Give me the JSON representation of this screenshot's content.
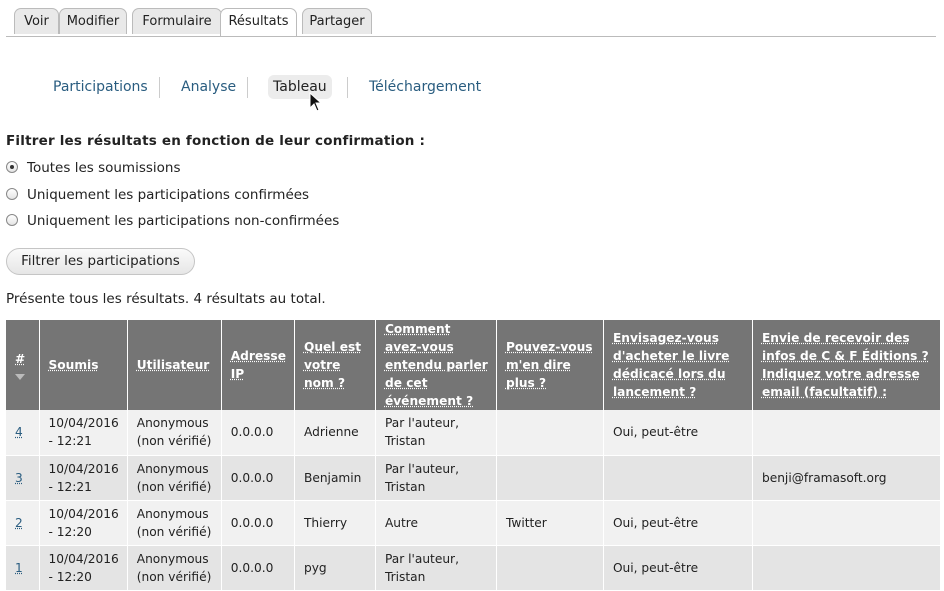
{
  "primary_tabs": [
    "Voir",
    "Modifier",
    "Formulaire",
    "Résultats",
    "Partager"
  ],
  "secondary_tabs": [
    "Participations",
    "Analyse",
    "Tableau",
    "Téléchargement"
  ],
  "filter": {
    "title": "Filtrer les résultats en fonction de leur confirmation :",
    "options": [
      "Toutes les soumissions",
      "Uniquement les participations confirmées",
      "Uniquement les participations non-confirmées"
    ],
    "selected": "Toutes les soumissions",
    "button": "Filtrer les participations"
  },
  "summary": "Présente tous les résultats. 4 résultats au total.",
  "table": {
    "headers": [
      "#",
      "Soumis",
      "Utilisateur",
      "Adresse IP",
      "Quel est votre nom ?",
      "Comment avez-vous entendu parler de cet événement ?",
      "Pouvez-vous m'en dire plus ?",
      "Envisagez-vous d'acheter le livre dédicacé lors du lancement ?",
      "Envie de recevoir des infos de C & F Éditions ? Indiquez votre adresse email (facultatif) :"
    ],
    "rows": [
      [
        "4",
        "10/04/2016 - 12:21",
        "Anonymous (non vérifié)",
        "0.0.0.0",
        "Adrienne",
        "Par l'auteur, Tristan",
        "",
        "Oui, peut-être",
        ""
      ],
      [
        "3",
        "10/04/2016 - 12:21",
        "Anonymous (non vérifié)",
        "0.0.0.0",
        "Benjamin",
        "Par l'auteur, Tristan",
        "",
        "",
        "benji@framasoft.org"
      ],
      [
        "2",
        "10/04/2016 - 12:20",
        "Anonymous (non vérifié)",
        "0.0.0.0",
        "Thierry",
        "Autre",
        "Twitter",
        "Oui, peut-être",
        ""
      ],
      [
        "1",
        "10/04/2016 - 12:20",
        "Anonymous (non vérifié)",
        "0.0.0.0",
        "pyg",
        "Par l'auteur, Tristan",
        "",
        "Oui, peut-être",
        ""
      ]
    ]
  }
}
